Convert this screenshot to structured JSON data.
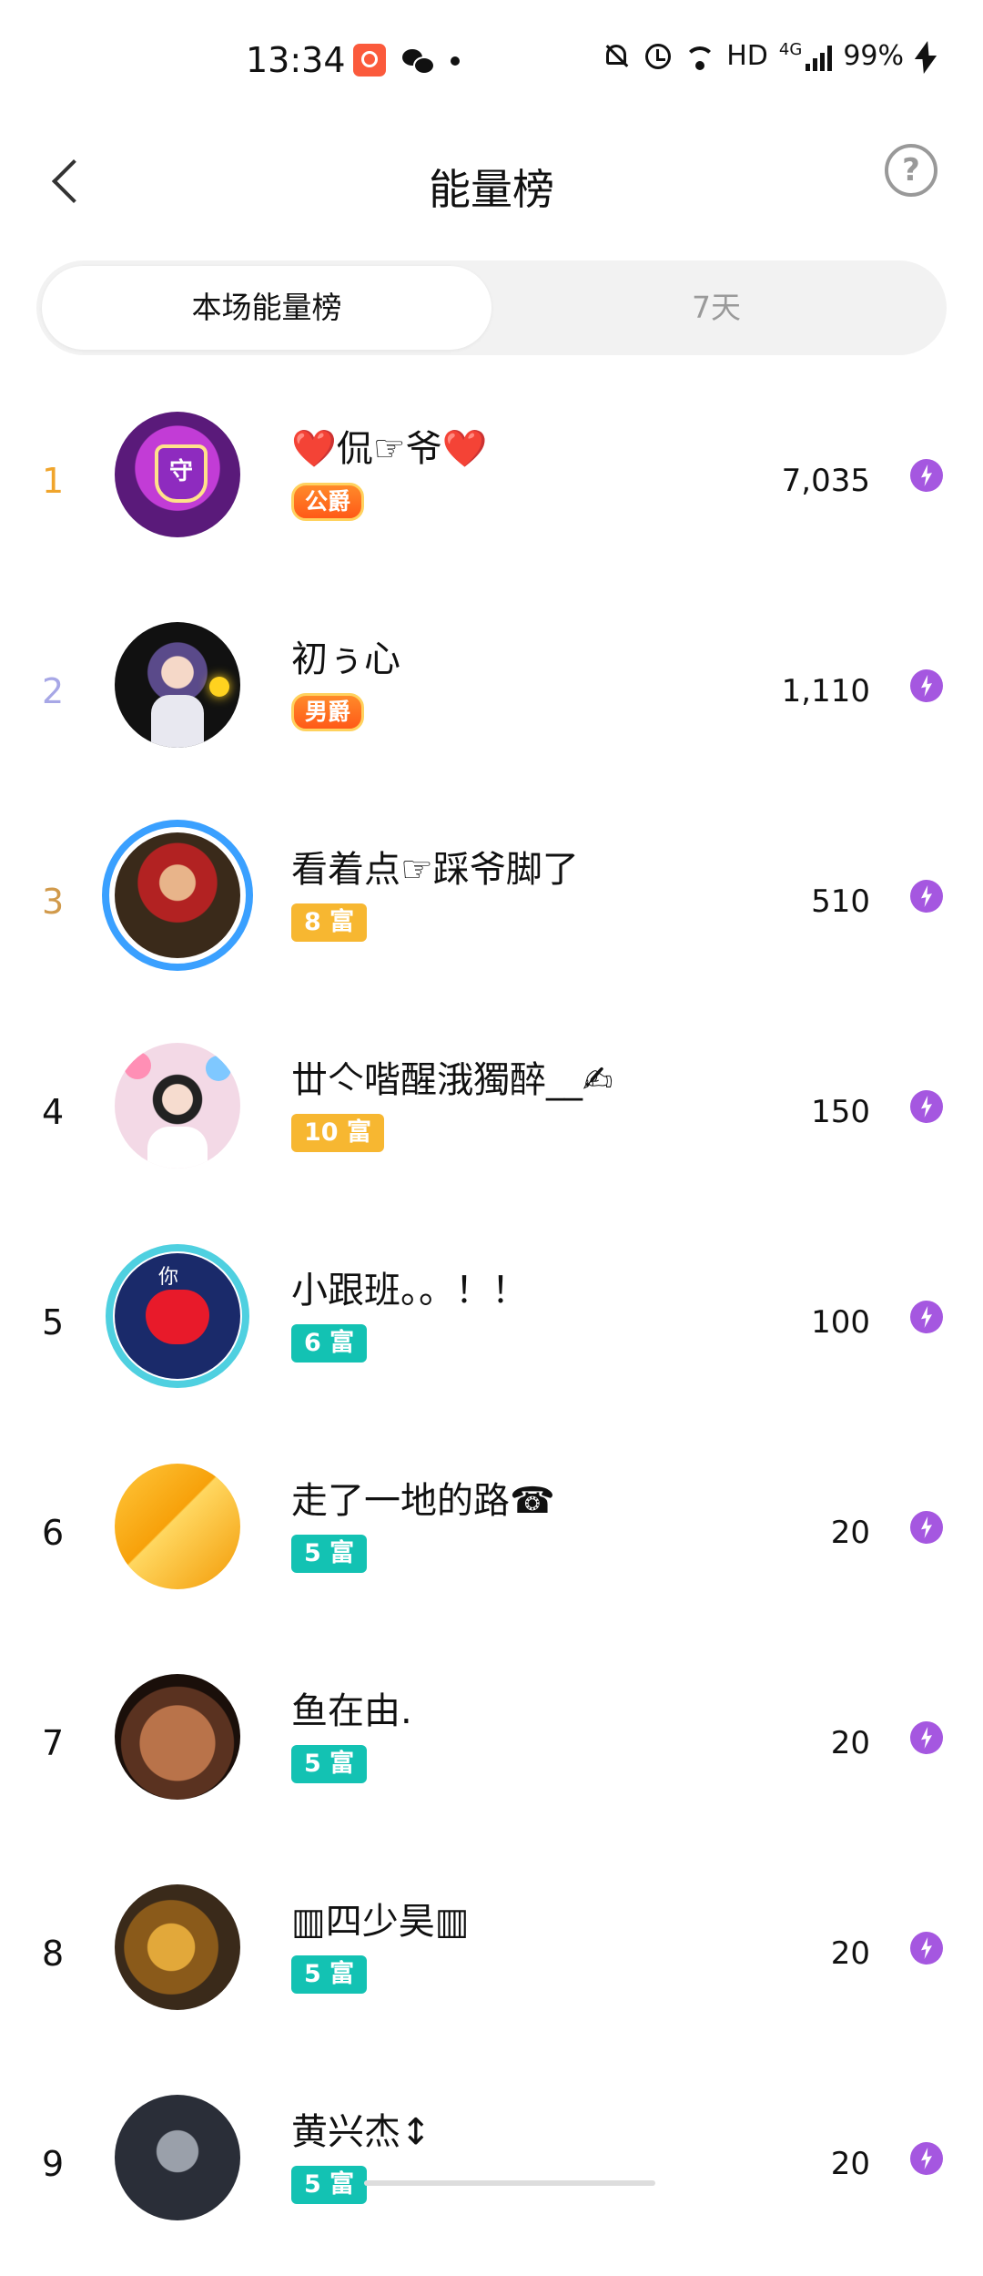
{
  "status_bar": {
    "time": "13:34",
    "network": "HD",
    "signal": "4G",
    "battery": "99%"
  },
  "header": {
    "title": "能量榜",
    "back_icon": "chevron-left-icon",
    "help_icon": "question-circle-icon"
  },
  "tabs": [
    {
      "label": "本场能量榜",
      "active": true
    },
    {
      "label": "7天",
      "active": false
    }
  ],
  "colors": {
    "rank_1": "#f0a52c",
    "rank_2": "#a7a7e6",
    "rank_3": "#d19a4b",
    "rank_default": "#111111",
    "energy_icon": "#a557e0"
  },
  "ranking": [
    {
      "rank": "1",
      "name": "❤️侃☞爷❤️",
      "badge": "公爵",
      "energy": "7,035"
    },
    {
      "rank": "2",
      "name": "初ぅ心",
      "badge": "男爵",
      "energy": "1,110"
    },
    {
      "rank": "3",
      "name": "看着点☞踩爷脚了",
      "badge": "8 富",
      "energy": "510"
    },
    {
      "rank": "4",
      "name": "丗亽喈醒涐獨醉__✍",
      "badge": "10 富",
      "energy": "150"
    },
    {
      "rank": "5",
      "name": "小跟班。。！！",
      "badge": "6 富",
      "energy": "100"
    },
    {
      "rank": "6",
      "name": "走了一地的路☎",
      "badge": "5 富",
      "energy": "20"
    },
    {
      "rank": "7",
      "name": "鱼在由.",
      "badge": "5 富",
      "energy": "20"
    },
    {
      "rank": "8",
      "name": "▥四少昊▥",
      "badge": "5 富",
      "energy": "20"
    },
    {
      "rank": "9",
      "name": "黄兴杰↕",
      "badge": "5 富",
      "energy": "20"
    }
  ]
}
